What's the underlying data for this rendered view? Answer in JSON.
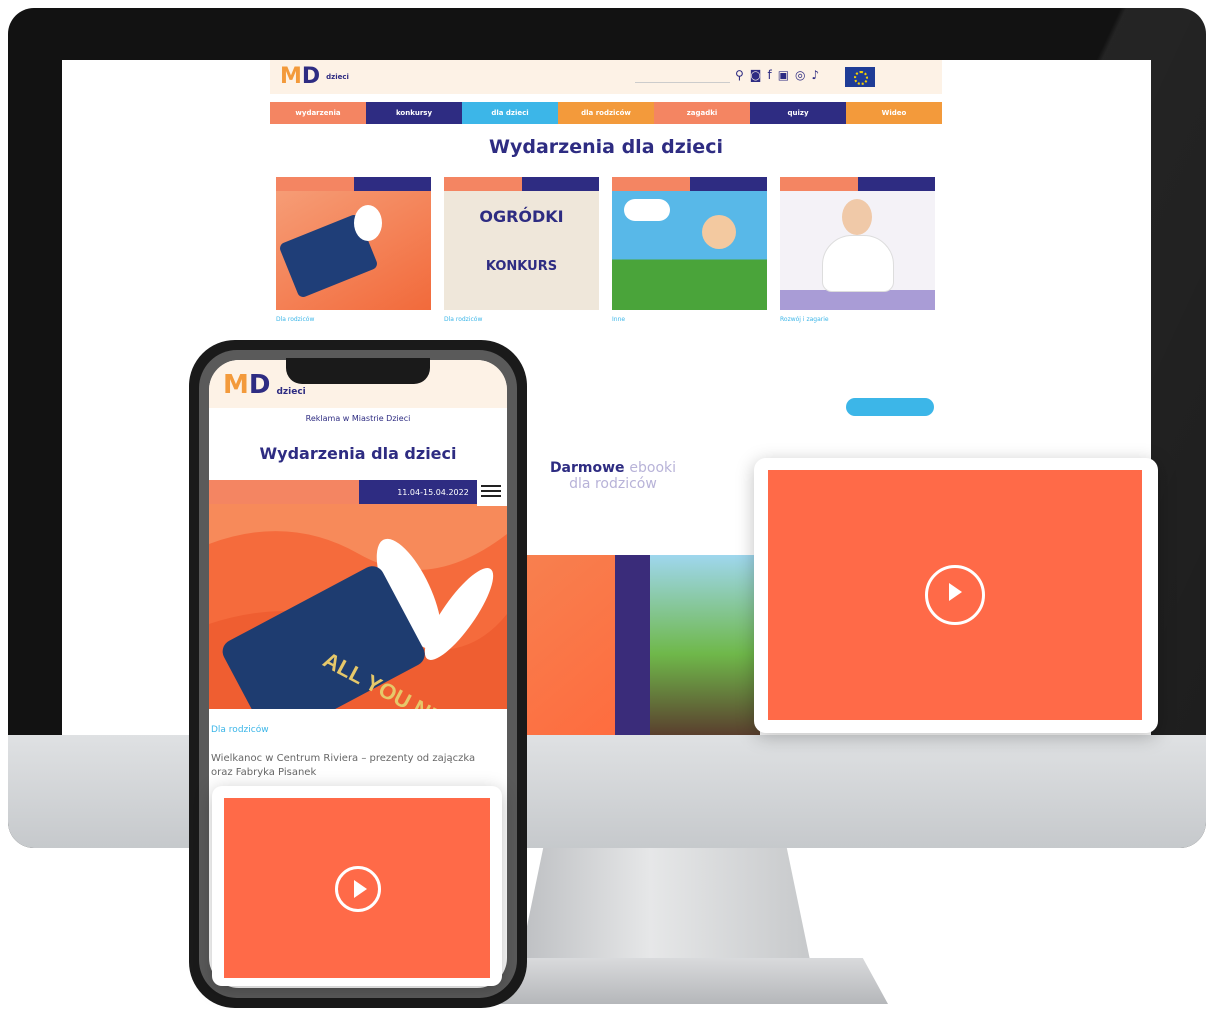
{
  "desktop": {
    "site_title": "Wydarzenia dla dzieci",
    "logo_text": "dzieci",
    "nav": [
      {
        "label": "wydarzenia",
        "color": "#f48562"
      },
      {
        "label": "konkursy",
        "color": "#2e2c82"
      },
      {
        "label": "dla dzieci",
        "color": "#3cb6e8"
      },
      {
        "label": "dla rodziców",
        "color": "#f39a3b"
      },
      {
        "label": "zagadki",
        "color": "#f48562"
      },
      {
        "label": "quizy",
        "color": "#2e2c82"
      },
      {
        "label": "Wideo",
        "color": "#f39a3b"
      }
    ],
    "cards": [
      {
        "cat": "Dla rodziców"
      },
      {
        "cat": "Dla rodziców",
        "img_title": "OGRÓDKI",
        "img_sub": "KONKURS"
      },
      {
        "cat": "Inne"
      },
      {
        "cat": "Rozwój i zagarie"
      }
    ],
    "ebook_bold": "Darmowe",
    "ebook_light": "ebooki",
    "ebook_line2": "dla rodziców"
  },
  "phone": {
    "logo_text": "dzieci",
    "reklama": "Reklama w Miastrie Dzieci",
    "title": "Wydarzenia dla dzieci",
    "tag_date": "11.04-15.04.2022",
    "hero_text": "ALL YOU NEED",
    "category": "Dla rodziców",
    "description": "Wielkanoc w Centrum Riviera – prezenty od zajączka oraz Fabryka Pisanek"
  },
  "colors": {
    "brand_navy": "#2e2c82",
    "brand_orange": "#f39a3b",
    "brand_coral": "#f48562",
    "brand_blue": "#3cb6e8",
    "video_bg": "#ff6a48"
  },
  "icons": [
    "play-icon",
    "search-icon",
    "hamburger-icon"
  ]
}
